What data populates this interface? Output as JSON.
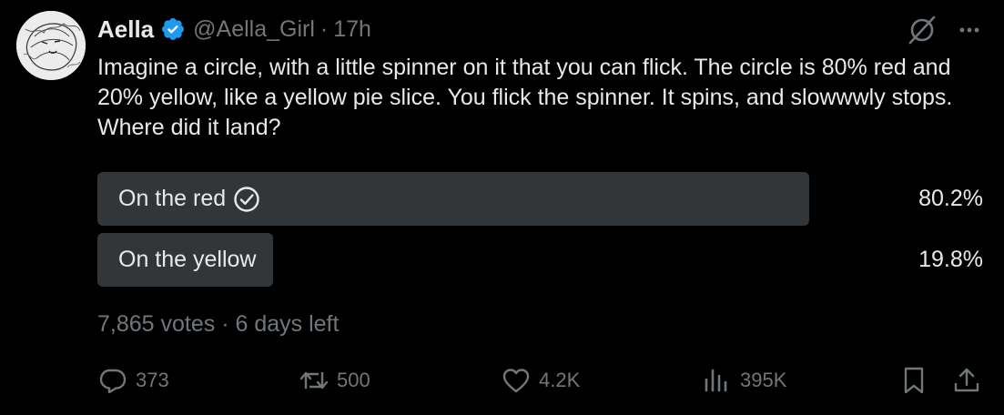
{
  "author": {
    "name": "Aella",
    "handle": "@Aella_Girl",
    "separator": "·",
    "time": "17h"
  },
  "tweet": {
    "text": "Imagine a circle, with a little spinner on it that you can flick. The circle is 80% red and 20% yellow, like a yellow pie slice. You flick the spinner. It spins, and slowwwly stops.  Where did it land?"
  },
  "poll": {
    "options": [
      {
        "label": "On the red",
        "percent": "80.2%",
        "fraction": 0.802,
        "chosen": true
      },
      {
        "label": "On the yellow",
        "percent": "19.8%",
        "fraction": 0.198,
        "chosen": false
      }
    ],
    "votes": "7,865 votes",
    "meta_sep": "·",
    "time_left": "6 days left"
  },
  "actions": {
    "replies": "373",
    "reposts": "500",
    "likes": "4.2K",
    "views": "395K"
  },
  "colors": {
    "background": "#000000",
    "text": "#e7e9ea",
    "muted": "#71767b",
    "bar": "#333639",
    "verified": "#1d9bf0"
  },
  "icons": [
    "verified-badge-icon",
    "grok-icon",
    "more-icon",
    "check-circle-icon",
    "reply-icon",
    "repost-icon",
    "like-icon",
    "views-icon",
    "bookmark-icon",
    "share-icon"
  ]
}
